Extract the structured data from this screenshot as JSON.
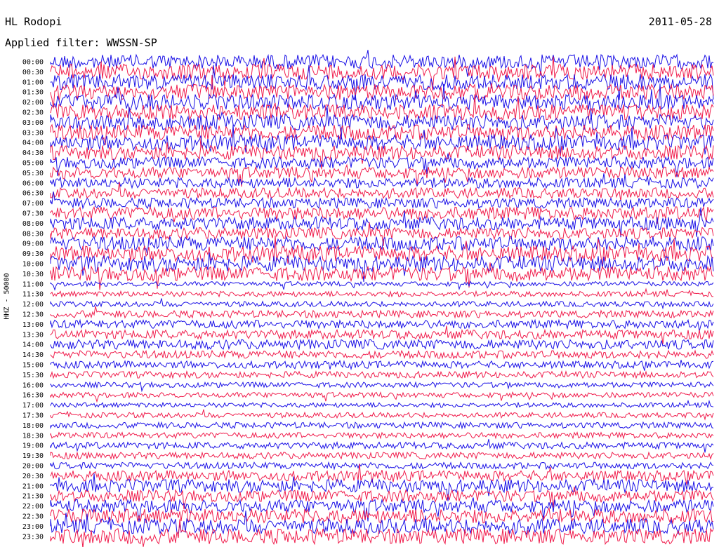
{
  "header": {
    "station": "HL Rodopi",
    "filter": "Applied filter: WWSSN-SP",
    "date": "2011-05-28"
  },
  "colors": {
    "trace_a": "#1a10e6",
    "trace_b": "#f01c4c"
  },
  "chart_data": {
    "type": "line",
    "subtype": "helicorder",
    "ylabel": "HHZ - 50000",
    "row_labels": [
      "00:00",
      "00:30",
      "01:00",
      "01:30",
      "02:00",
      "02:30",
      "03:00",
      "03:30",
      "04:00",
      "04:30",
      "05:00",
      "05:30",
      "06:00",
      "06:30",
      "07:00",
      "07:30",
      "08:00",
      "08:30",
      "09:00",
      "09:30",
      "10:00",
      "10:30",
      "11:00",
      "11:30",
      "12:00",
      "12:30",
      "13:00",
      "13:30",
      "14:00",
      "14:30",
      "15:00",
      "15:30",
      "16:00",
      "16:30",
      "17:00",
      "17:30",
      "18:00",
      "18:30",
      "19:00",
      "19:30",
      "20:00",
      "20:30",
      "21:00",
      "21:30",
      "22:00",
      "22:30",
      "23:00",
      "23:30"
    ],
    "row_activity": [
      0.9,
      1.0,
      1.0,
      1.0,
      1.0,
      1.0,
      1.0,
      1.0,
      1.0,
      0.9,
      0.7,
      0.7,
      0.6,
      0.6,
      0.6,
      0.8,
      0.8,
      0.7,
      0.9,
      1.0,
      1.0,
      0.9,
      0.15,
      0.2,
      0.2,
      0.35,
      0.45,
      0.5,
      0.55,
      0.4,
      0.35,
      0.3,
      0.2,
      0.2,
      0.15,
      0.2,
      0.25,
      0.25,
      0.3,
      0.3,
      0.3,
      0.6,
      0.8,
      0.7,
      0.8,
      0.9,
      0.95,
      1.0
    ],
    "grid": false,
    "legend": "none"
  }
}
